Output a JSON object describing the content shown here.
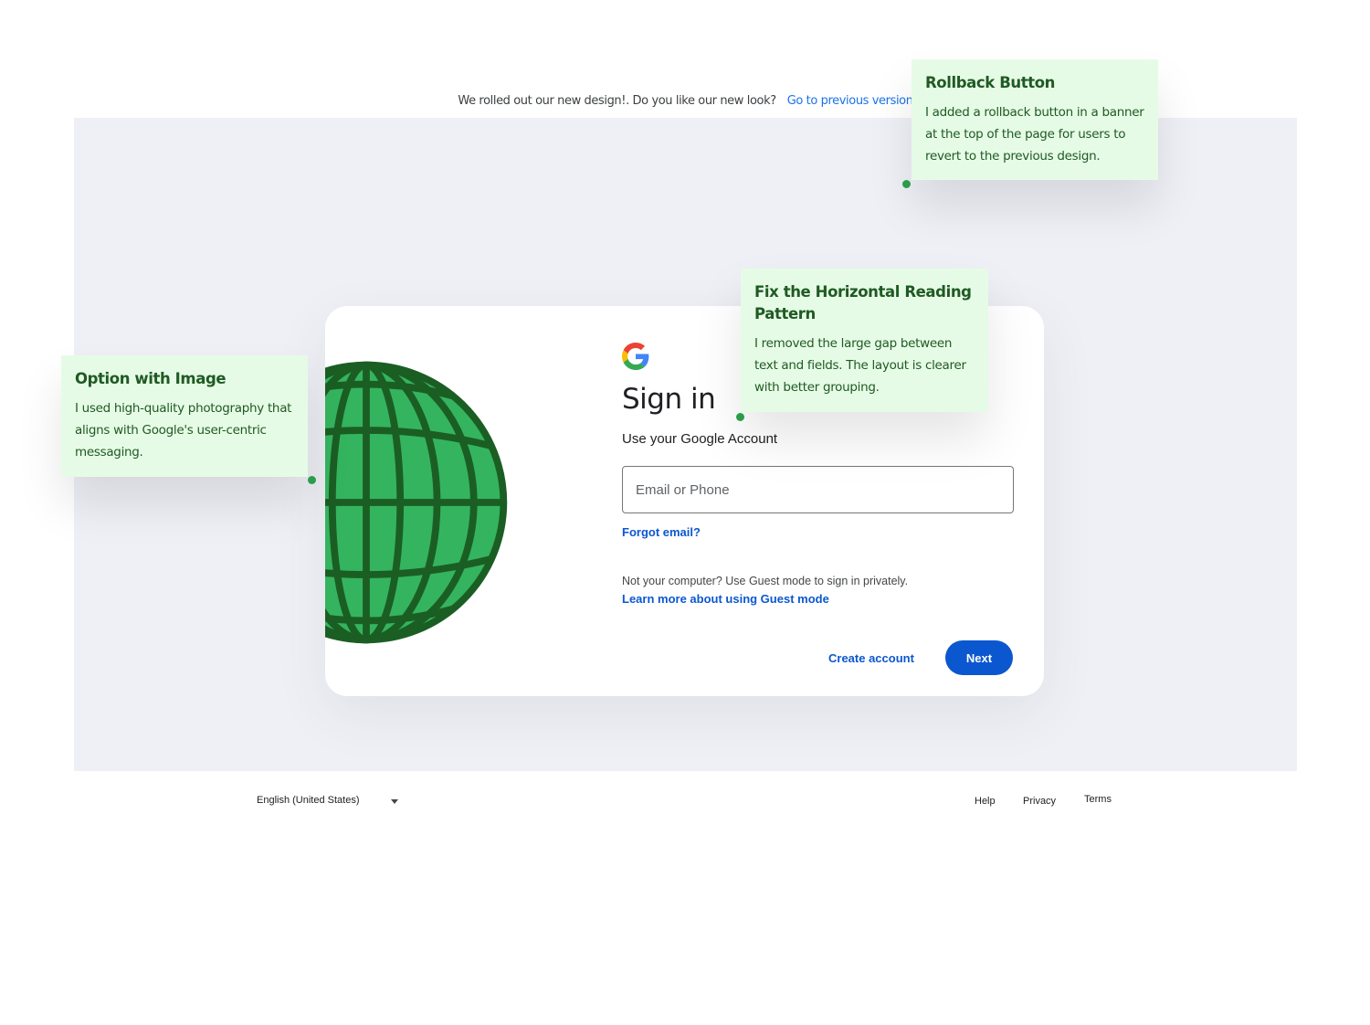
{
  "banner": {
    "message": "We rolled out our new design!. Do you like our new look?",
    "link_label": "Go to previous version"
  },
  "signin": {
    "logo_icon": "google-g-icon",
    "title": "Sign in",
    "subtitle": "Use your Google Account",
    "email_placeholder": "Email or Phone",
    "email_value": "",
    "forgot_label": "Forgot email?",
    "guest_text": "Not your computer? Use Guest mode to sign in privately.",
    "guest_link": "Learn more about using Guest mode",
    "create_label": "Create account",
    "next_label": "Next",
    "illustration_icon": "globe-icon"
  },
  "footer": {
    "language": "English (United States)",
    "links": [
      "Help",
      "Privacy",
      "Terms"
    ]
  },
  "notes": [
    {
      "title": "Rollback Button",
      "body": "I added a rollback button in a banner at the top of the page for users to revert to the previous design."
    },
    {
      "title": "Fix the Horizontal Reading Pattern",
      "body": "I removed the large gap between text and fields. The layout is clearer with better grouping."
    },
    {
      "title": "Option with Image",
      "body": "I used high-quality photography that aligns with Google's user-centric messaging."
    }
  ],
  "colors": {
    "primary": "#0b57d0",
    "banner_link": "#1a73e8",
    "page_bg": "#eef0f6",
    "note_bg": "#e6fbe6",
    "note_text": "#1f5a23",
    "globe_fill": "#34b45e",
    "globe_stroke": "#1b5e24"
  }
}
